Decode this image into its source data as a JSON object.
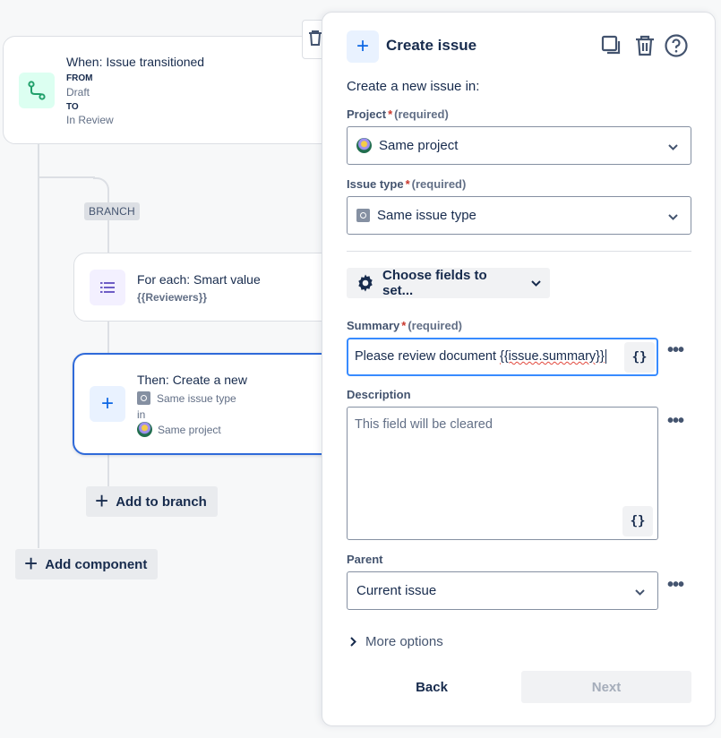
{
  "canvas": {
    "trigger": {
      "title": "When: Issue transitioned",
      "from_label": "FROM",
      "from_value": "Draft",
      "to_label": "TO",
      "to_value": "In Review"
    },
    "branch_label": "BRANCH",
    "for_each": {
      "title": "For each: Smart value",
      "value": "{{Reviewers}}"
    },
    "action": {
      "title": "Then: Create a new",
      "issue_type": "Same issue type",
      "in_label": "in",
      "project": "Same project"
    },
    "add_to_branch": "Add to branch",
    "add_component": "Add component"
  },
  "panel": {
    "title": "Create issue",
    "subtitle": "Create a new issue in:",
    "project": {
      "label": "Project",
      "required": "*",
      "note": "(required)",
      "value": "Same project"
    },
    "issue_type": {
      "label": "Issue type",
      "required": "*",
      "note": "(required)",
      "value": "Same issue type"
    },
    "choose_fields": "Choose fields to set...",
    "summary": {
      "label": "Summary",
      "required": "*",
      "note": "(required)",
      "value_prefix": "Please review document ",
      "value_smart": "{{issue.summary}}"
    },
    "description": {
      "label": "Description",
      "placeholder": "This field will be cleared"
    },
    "parent": {
      "label": "Parent",
      "value": "Current issue"
    },
    "more_options": "More options",
    "back": "Back",
    "next": "Next",
    "smart_value_button": "{}",
    "icons": {
      "header": "plus-icon",
      "tools": [
        "copy-icon",
        "trash-icon",
        "help-icon"
      ]
    },
    "colors": {
      "accent": "#0c66e4",
      "focus_border": "#388bff",
      "required": "#c9372c",
      "disabled_bg": "#f1f2f4"
    }
  }
}
